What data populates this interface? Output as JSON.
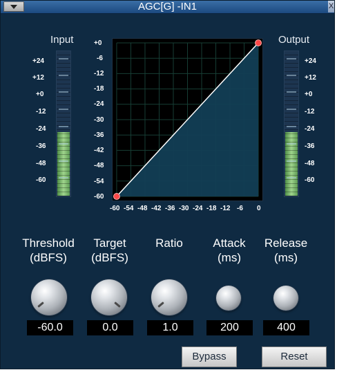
{
  "window": {
    "title": "AGC[G] -IN1",
    "close_glyph": "X"
  },
  "input_meter": {
    "label": "Input",
    "ticks": [
      "+24",
      "+12",
      "+0",
      "-12",
      "-24",
      "-36",
      "-48",
      "-60"
    ],
    "level_fraction": 0.44
  },
  "output_meter": {
    "label": "Output",
    "ticks": [
      "+24",
      "+12",
      "+0",
      "-12",
      "-24",
      "-36",
      "-48",
      "-60"
    ],
    "level_fraction": 0.44
  },
  "graph": {
    "y_ticks": [
      "+0",
      "-6",
      "-12",
      "-18",
      "-24",
      "-30",
      "-36",
      "-42",
      "-48",
      "-54",
      "-60"
    ],
    "x_ticks": [
      "-60",
      "-54",
      "-48",
      "-42",
      "-36",
      "-30",
      "-24",
      "-18",
      "-12",
      "-6",
      "0"
    ],
    "curve_points": [
      {
        "x": -60,
        "y": -60
      },
      {
        "x": 0,
        "y": 0
      }
    ],
    "range": [
      -60,
      0
    ],
    "colors": {
      "background": "#000000",
      "grid": "#173e35",
      "fill": "#123e55",
      "curve": "#ffffff",
      "point": "#ff4848"
    }
  },
  "controls": {
    "threshold": {
      "label1": "Threshold",
      "label2": "(dBFS)",
      "value": "-60.0"
    },
    "target": {
      "label1": "Target",
      "label2": "(dBFS)",
      "value": "0.0"
    },
    "ratio": {
      "label1": "Ratio",
      "label2": "",
      "value": "1.0"
    },
    "attack": {
      "label1": "Attack",
      "label2": "(ms)",
      "value": "200"
    },
    "release": {
      "label1": "Release",
      "label2": "(ms)",
      "value": "400"
    }
  },
  "buttons": {
    "bypass": "Bypass",
    "reset": "Reset"
  },
  "colors": {
    "panel": "#0f2a42",
    "titlebar": "#2d5f97",
    "meter_fill": "#8cc97b"
  }
}
